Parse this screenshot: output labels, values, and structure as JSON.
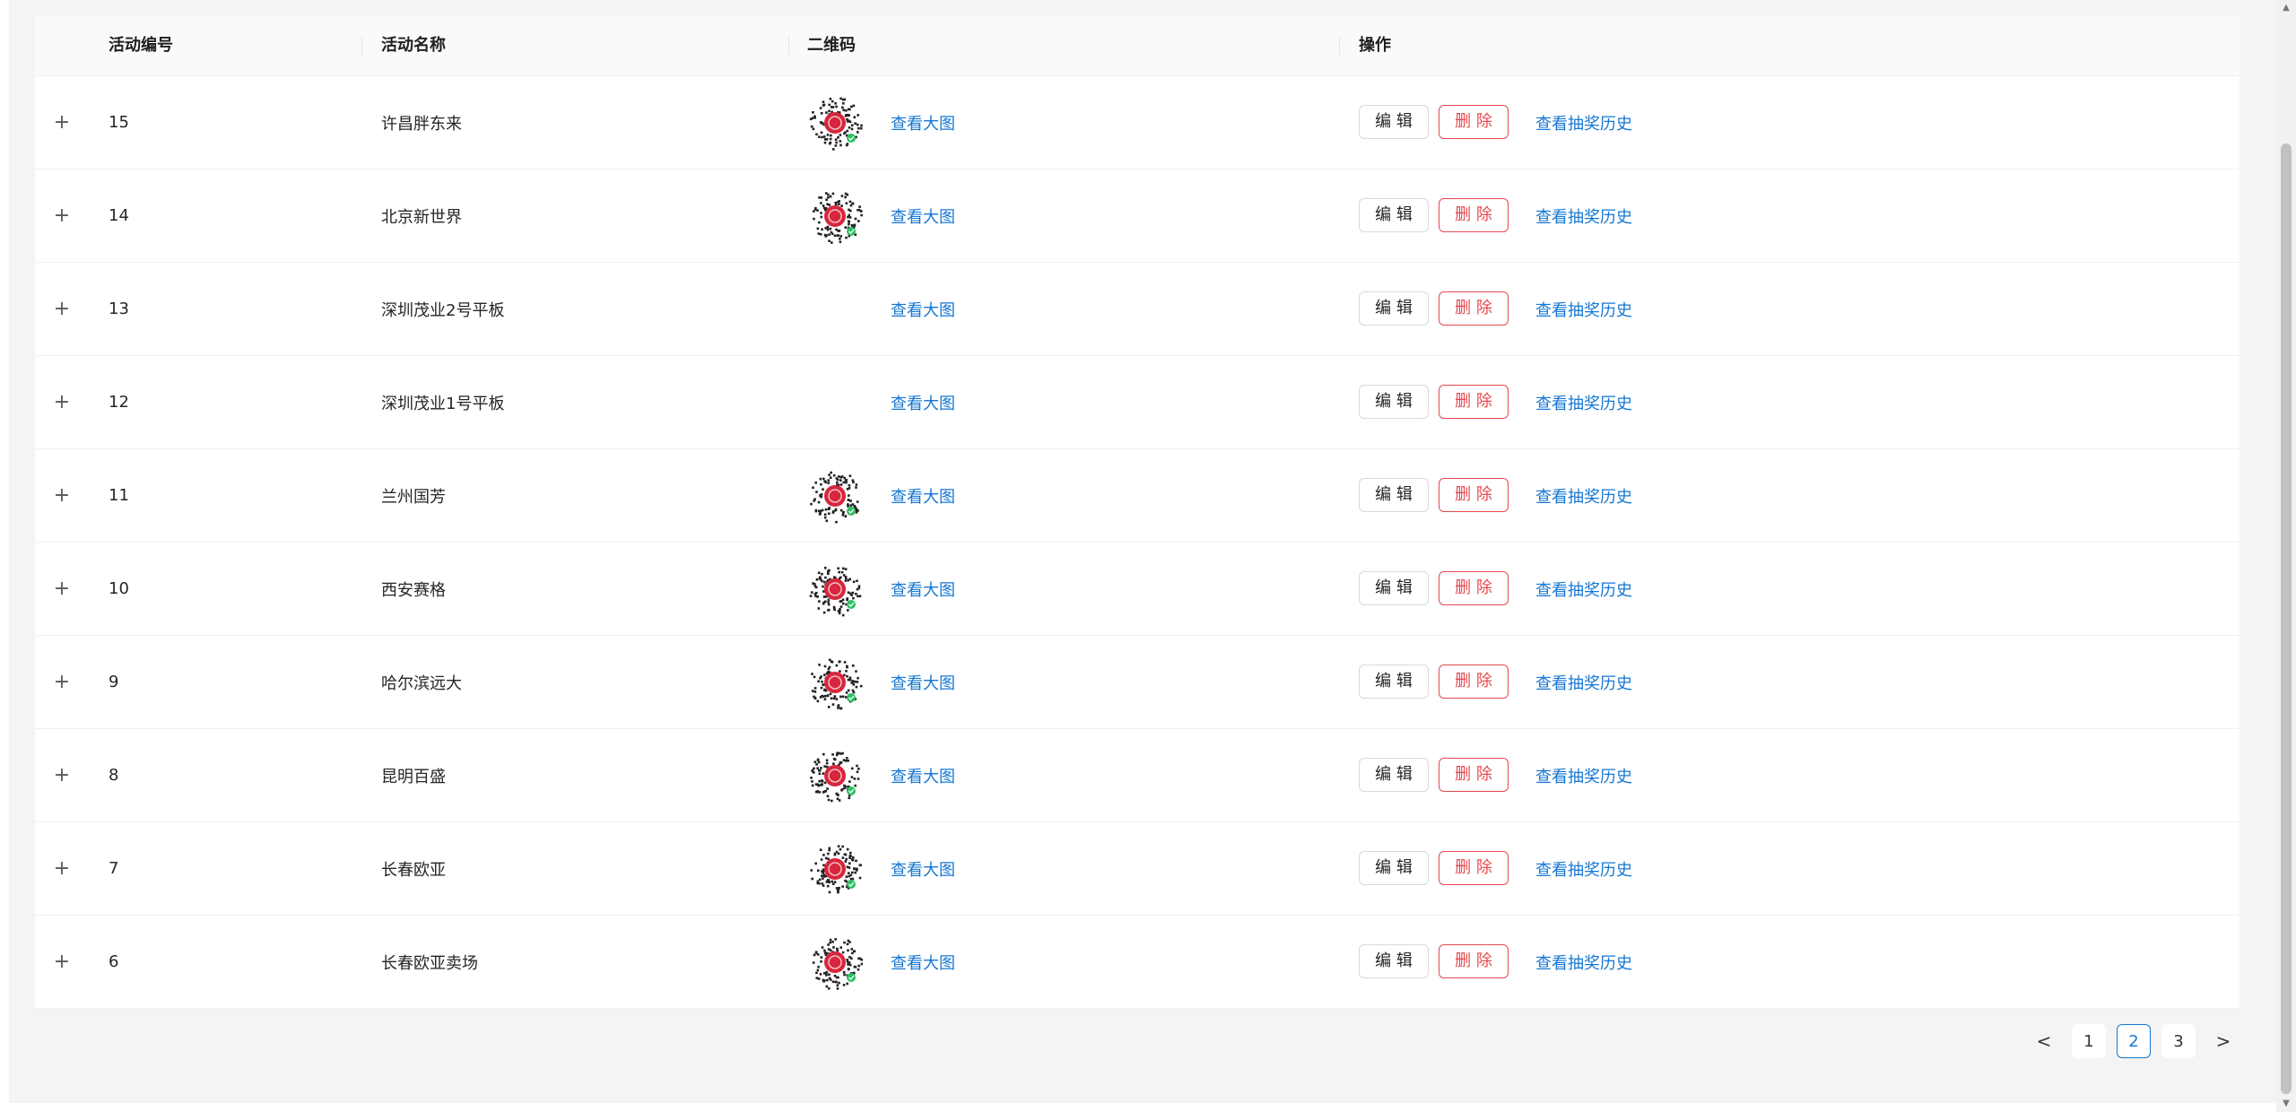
{
  "table": {
    "headers": {
      "activity_id": "活动编号",
      "activity_name": "活动名称",
      "qrcode": "二维码",
      "actions": "操作"
    },
    "rows": [
      {
        "id": "15",
        "name": "许昌胖东来",
        "has_qr": true
      },
      {
        "id": "14",
        "name": "北京新世界",
        "has_qr": true
      },
      {
        "id": "13",
        "name": "深圳茂业2号平板",
        "has_qr": false
      },
      {
        "id": "12",
        "name": "深圳茂业1号平板",
        "has_qr": false
      },
      {
        "id": "11",
        "name": "兰州国芳",
        "has_qr": true
      },
      {
        "id": "10",
        "name": "西安赛格",
        "has_qr": true
      },
      {
        "id": "9",
        "name": "哈尔滨远大",
        "has_qr": true
      },
      {
        "id": "8",
        "name": "昆明百盛",
        "has_qr": true
      },
      {
        "id": "7",
        "name": "长春欧亚",
        "has_qr": true
      },
      {
        "id": "6",
        "name": "长春欧亚卖场",
        "has_qr": true
      }
    ],
    "expand_label": "+",
    "view_large_label": "查看大图",
    "edit_label": "编 辑",
    "delete_label": "删 除",
    "history_label": "查看抽奖历史"
  },
  "pagination": {
    "prev_label": "<",
    "next_label": ">",
    "pages": [
      "1",
      "2",
      "3"
    ],
    "current": "2"
  },
  "colors": {
    "link": "#1677d2",
    "danger": "#e5484d",
    "qr_center": "#d7263d"
  }
}
